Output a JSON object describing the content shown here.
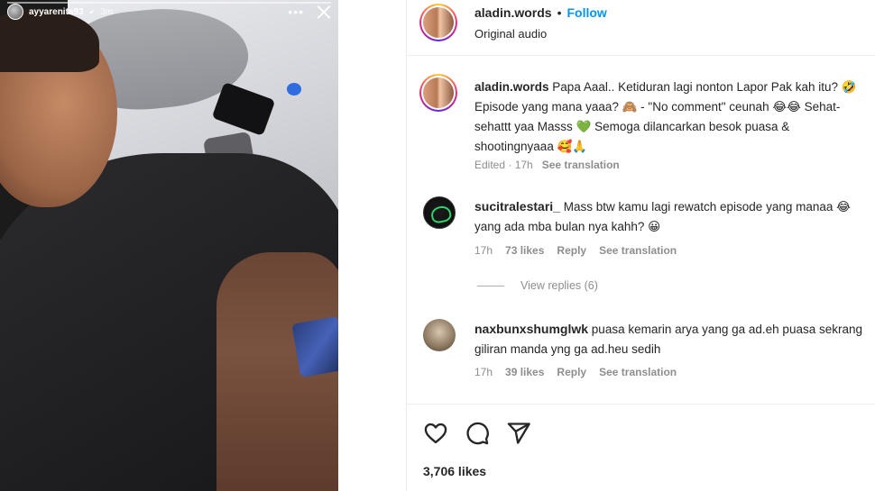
{
  "story": {
    "username": "ayyarenita93",
    "verified_badge": "✔",
    "time_ago": "3m",
    "more_icon": "more-horizontal-icon",
    "close_icon": "close-icon"
  },
  "post": {
    "author": "aladin.words",
    "separator": "•",
    "follow_label": "Follow",
    "audio": "Original audio",
    "caption": {
      "username": "aladin.words",
      "text": "Papa Aaal.. Ketiduran lagi nonton Lapor Pak kah itu? 🤣 Episode yang mana yaaa? 🙈 - \"No comment\" ceunah 😂😂 Sehat-sehattt yaa Masss 💚 Semoga dilancarkan besok puasa & shootingnyaaa 🥰🙏",
      "edited": "Edited · 17h",
      "see_translation": "See translation"
    },
    "comments": [
      {
        "username": "sucitralestari_",
        "text": "Mass btw kamu lagi rewatch episode yang manaa 😂 yang ada mba bulan nya kahh? 😀",
        "time": "17h",
        "likes": "73 likes",
        "reply": "Reply",
        "see_translation": "See translation"
      },
      {
        "username": "naxbunxshumglwk",
        "text": "puasa kemarin arya yang ga ad.eh puasa sekrang giliran manda yng ga ad.heu sedih",
        "time": "17h",
        "likes": "39 likes",
        "reply": "Reply",
        "see_translation": "See translation"
      }
    ],
    "view_replies": "View replies (6)",
    "likes_total": "3,706 likes",
    "actions": [
      "heart-icon",
      "comment-icon",
      "share-icon"
    ]
  }
}
